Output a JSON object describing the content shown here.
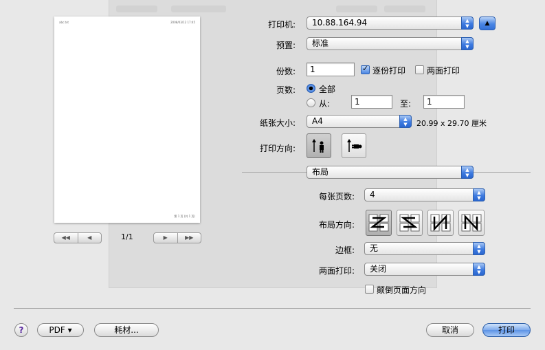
{
  "preview": {
    "header_left": "abc.txt",
    "header_right": "2008/03/12 17:45",
    "footer_right": "第 1 页 (共 1 页)",
    "page_indicator": "1/1",
    "nav_first": "◀◀",
    "nav_prev": "◀",
    "nav_next": "▶",
    "nav_last": "▶▶"
  },
  "printer": {
    "label": "打印机:",
    "value": "10.88.164.94"
  },
  "presets": {
    "label": "预置:",
    "value": "标准"
  },
  "copies": {
    "label": "份数:",
    "value": "1",
    "collate_label": "逐份打印",
    "collate_checked": true,
    "duplex_label": "两面打印",
    "duplex_checked": false
  },
  "pages": {
    "label": "页数:",
    "all_label": "全部",
    "from_label": "从:",
    "from_value": "1",
    "to_label": "至:",
    "to_value": "1",
    "selected": "all"
  },
  "paper_size": {
    "label": "纸张大小:",
    "value": "A4",
    "dimensions": "20.99 x 29.70 厘米"
  },
  "orientation": {
    "label": "打印方向:",
    "selected": "portrait"
  },
  "section": {
    "value": "布局"
  },
  "layout": {
    "pages_per_sheet_label": "每张页数:",
    "pages_per_sheet_value": "4",
    "direction_label": "布局方向:",
    "border_label": "边框:",
    "border_value": "无",
    "two_sided_label": "两面打印:",
    "two_sided_value": "关闭",
    "reverse_label": "颠倒页面方向",
    "reverse_checked": false
  },
  "footer": {
    "help": "?",
    "pdf_label": "PDF ▾",
    "supplies_label": "耗材...",
    "cancel_label": "取消",
    "print_label": "打印"
  },
  "colors": {
    "accent": "#3e7be0",
    "window_bg": "#e8e8e8"
  }
}
